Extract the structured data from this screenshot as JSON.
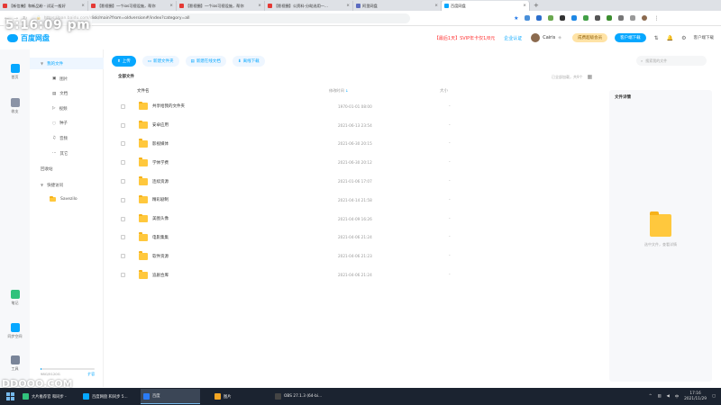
{
  "browser": {
    "tabs": [
      {
        "title": "【新信機】和新品粉 - 试证一般好",
        "favicon_color": "#e53935",
        "active": false
      },
      {
        "title": "【影视圈】一个ios可视设施，帮你",
        "favicon_color": "#e53935",
        "active": false
      },
      {
        "title": "【影视圈】一个ios可视设施，帮你",
        "favicon_color": "#e53935",
        "active": false
      },
      {
        "title": "【影视圈】公资料-分助选用一...",
        "favicon_color": "#e53935",
        "active": false
      },
      {
        "title": "阿里网盘",
        "favicon_color": "#5c6bc0",
        "active": false
      },
      {
        "title": "百度网盘",
        "favicon_color": "#06a7ff",
        "active": true
      }
    ],
    "url": "https://pan.baidu.com/disk/main?from=oldversion#/index?category=all",
    "clock_overlay": "5:16:09 pm"
  },
  "app": {
    "logo": "百度网盘",
    "promo": "【最后1天】SVIP年卡仅1/8元",
    "certify": "企业认证",
    "username": "Cairis",
    "vip_button": "成费超级会员",
    "blue_button": "客户端下载",
    "client_download": "客户端下载"
  },
  "rail": [
    {
      "label": "首页",
      "color": "#06a7ff"
    },
    {
      "label": "收支",
      "color": "#8a93a6"
    },
    {
      "label": "笔记",
      "color": "#31c27c"
    },
    {
      "label": "同步空间",
      "color": "#06a7ff"
    },
    {
      "label": "工具",
      "color": "#7a8599"
    }
  ],
  "tree": {
    "my_files": "我的文件",
    "subs": [
      "图片",
      "文档",
      "视频",
      "种子",
      "音频",
      "其它"
    ],
    "recycle": "回收站",
    "quick": "快捷访问",
    "quick_items": [
      "Savezilo"
    ],
    "storage_text": "98G/5120G",
    "storage_fraction": 0.02,
    "expand": "扩容"
  },
  "toolbar": {
    "upload": "上传",
    "new_folder": "新建文件夹",
    "new_doc": "新建在线文档",
    "offline": "离线下载"
  },
  "search_placeholder": "搜索我的文件",
  "all_files": "全部文件",
  "loaded_text": "已全部加载，共9个",
  "columns": {
    "name": "文件名",
    "time": "修改时间",
    "size": "大小"
  },
  "files": [
    {
      "name": "共享给我的文件夹",
      "time": "1970-01-01 08:00",
      "size": "-"
    },
    {
      "name": "安卓应用",
      "time": "2021-06-13 23:54",
      "size": "-"
    },
    {
      "name": "影视媒体",
      "time": "2021-06-30 20:15",
      "size": "-"
    },
    {
      "name": "学休学费",
      "time": "2021-06-30 20:12",
      "size": "-"
    },
    {
      "name": "连续资源",
      "time": "2021-01-06 17:07",
      "size": "-"
    },
    {
      "name": "精彩剧制",
      "time": "2021-04-14 21:58",
      "size": "-"
    },
    {
      "name": "美图头像",
      "time": "2021-04-09 16:26",
      "size": "-"
    },
    {
      "name": "电影集集",
      "time": "2021-04-06 21:24",
      "size": "-"
    },
    {
      "name": "软件资源",
      "time": "2021-04-06 21:23",
      "size": "-"
    },
    {
      "name": "追剧合库",
      "time": "2021-04-06 21:24",
      "size": "-"
    }
  ],
  "detail": {
    "title": "文件详情",
    "hint": "选中文件，查看详情"
  },
  "watermark": "DDOOO.COM",
  "taskbar": {
    "items": [
      {
        "label": "大片推荐官 和同步 -",
        "color": "#31c27c",
        "active": false
      },
      {
        "label": "百度网盘 和同步 5...",
        "color": "#06a7ff",
        "active": false
      },
      {
        "label": "百度",
        "color": "#2a7bf5",
        "active": true
      },
      {
        "label": "图片",
        "color": "#f5a623",
        "active": false
      },
      {
        "label": "OBS 27.1.3 (64-bi...",
        "color": "#444",
        "active": false
      }
    ],
    "time": "17:16",
    "date": "2021/11/29"
  }
}
